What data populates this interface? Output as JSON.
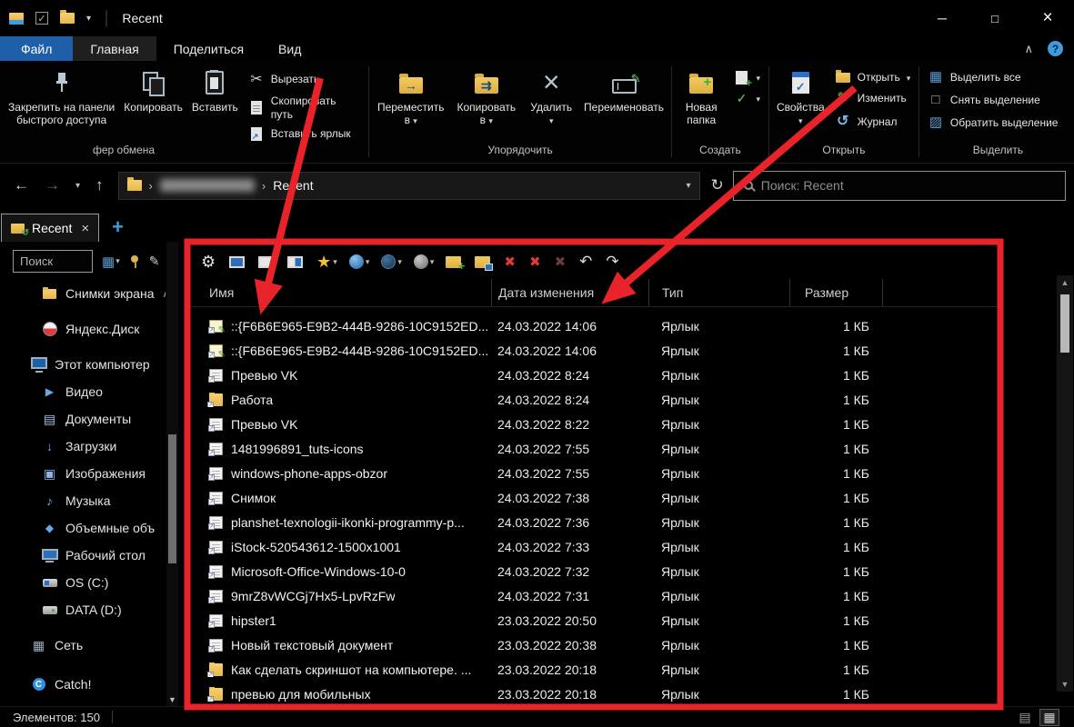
{
  "titlebar": {
    "title": "Recent",
    "quick_access_dropdown": "▾",
    "separator": "│",
    "controls": {
      "minimize": "─",
      "maximize": "□",
      "close": "×"
    }
  },
  "ribbon_tabs": {
    "file": "Файл",
    "home": "Главная",
    "share": "Поделиться",
    "view": "Вид",
    "collapse": "∧",
    "help": "?"
  },
  "ribbon": {
    "pin": "Закрепить на панели быстрого доступа",
    "copy": "Копировать",
    "paste": "Вставить",
    "cut": "Вырезать",
    "copy_path": "Скопировать путь",
    "paste_shortcut": "Вставить ярлык",
    "move_to": "Переместить в",
    "copy_to": "Копировать в",
    "delete": "Удалить",
    "rename": "Переименовать",
    "new_folder": "Новая папка",
    "properties": "Свойства",
    "open": "Открыть",
    "edit": "Изменить",
    "history": "Журнал",
    "select_all": "Выделить все",
    "select_none": "Снять выделение",
    "invert_selection": "Обратить выделение",
    "groups": {
      "clipboard": "фер обмена",
      "organize": "Упорядочить",
      "create": "Создать",
      "open": "Открыть",
      "select": "Выделить"
    }
  },
  "navbar": {
    "back": "←",
    "forward": "→",
    "history_dropdown": "▾",
    "up": "↑",
    "breadcrumb": {
      "separator": "›",
      "current": "Recent",
      "dropdown": "▾"
    },
    "refresh": "↻",
    "search_placeholder": "Поиск: Recent"
  },
  "tabbar": {
    "tab_label": "Recent",
    "close": "×",
    "new_tab": "+"
  },
  "sidebar": {
    "search_placeholder": "Поиск",
    "grid_icon": "▦",
    "grid_dropdown": "▾",
    "pen_icon": "✎",
    "items": [
      {
        "label": "Снимки экрана",
        "icon": "folder",
        "cls": "lvl1",
        "expander": "∧"
      },
      {
        "label": "Яндекс.Диск",
        "icon": "yandex",
        "cls": "lvl1 gap"
      },
      {
        "label": "Этот компьютер",
        "icon": "computer",
        "cls": "lvl0 gap"
      },
      {
        "label": "Видео",
        "icon": "videos",
        "cls": "lvl1"
      },
      {
        "label": "Документы",
        "icon": "documents",
        "cls": "lvl1"
      },
      {
        "label": "Загрузки",
        "icon": "downloads",
        "cls": "lvl1"
      },
      {
        "label": "Изображения",
        "icon": "pictures",
        "cls": "lvl1"
      },
      {
        "label": "Музыка",
        "icon": "music",
        "cls": "lvl1"
      },
      {
        "label": "Объемные объ",
        "icon": "objects3d",
        "cls": "lvl1"
      },
      {
        "label": "Рабочий стол",
        "icon": "desktop",
        "cls": "lvl1"
      },
      {
        "label": "OS (C:)",
        "icon": "drive-os",
        "cls": "lvl1"
      },
      {
        "label": "DATA (D:)",
        "icon": "drive",
        "cls": "lvl1"
      },
      {
        "label": "Сеть",
        "icon": "network",
        "cls": "lvl0 gap"
      },
      {
        "label": "Catch!",
        "icon": "catch",
        "cls": "lvl0 gap2"
      }
    ]
  },
  "list_toolbar": [
    {
      "name": "settings-button",
      "icon": "gear"
    },
    {
      "name": "window-view-1-button",
      "icon": "win-blue"
    },
    {
      "name": "window-view-2-button",
      "icon": "win-white"
    },
    {
      "name": "window-view-3-button",
      "icon": "win-split"
    },
    {
      "name": "favorites-button",
      "icon": "star",
      "dd": "▾"
    },
    {
      "name": "globe-blue-button",
      "icon": "globe-blue",
      "dd": "▾"
    },
    {
      "name": "globe-dark-button",
      "icon": "globe-dark",
      "dd": "▾"
    },
    {
      "name": "sphere-gray-button",
      "icon": "sphere-gray",
      "dd": "▾"
    },
    {
      "name": "new-folder-tab-button",
      "icon": "folder-plus"
    },
    {
      "name": "folder-window-button",
      "icon": "folder-win"
    },
    {
      "name": "close-tab-button",
      "icon": "x-red"
    },
    {
      "name": "close-tabs-button",
      "icon": "x-red"
    },
    {
      "name": "close-disabled-button",
      "icon": "x-dim"
    },
    {
      "name": "undo-close-button",
      "icon": "arrow-undo"
    },
    {
      "name": "redo-close-button",
      "icon": "arrow-redo"
    }
  ],
  "filelist": {
    "columns": [
      "Имя",
      "Дата изменения",
      "Тип",
      "Размер"
    ],
    "rows": [
      {
        "name": "::{F6B6E965-E9B2-444B-9286-10C9152ED...",
        "date": "24.03.2022 14:06",
        "type": "Ярлык",
        "size": "1 КБ",
        "icon": "note"
      },
      {
        "name": "::{F6B6E965-E9B2-444B-9286-10C9152ED...",
        "date": "24.03.2022 14:06",
        "type": "Ярлык",
        "size": "1 КБ",
        "icon": "note"
      },
      {
        "name": "Превью VK",
        "date": "24.03.2022 8:24",
        "type": "Ярлык",
        "size": "1 КБ",
        "icon": "doc"
      },
      {
        "name": "Работа",
        "date": "24.03.2022 8:24",
        "type": "Ярлык",
        "size": "1 КБ",
        "icon": "folder"
      },
      {
        "name": "Превью VK",
        "date": "24.03.2022 8:22",
        "type": "Ярлык",
        "size": "1 КБ",
        "icon": "doc"
      },
      {
        "name": "1481996891_tuts-icons",
        "date": "24.03.2022 7:55",
        "type": "Ярлык",
        "size": "1 КБ",
        "icon": "doc"
      },
      {
        "name": "windows-phone-apps-obzor",
        "date": "24.03.2022 7:55",
        "type": "Ярлык",
        "size": "1 КБ",
        "icon": "doc"
      },
      {
        "name": "Снимок",
        "date": "24.03.2022 7:38",
        "type": "Ярлык",
        "size": "1 КБ",
        "icon": "doc"
      },
      {
        "name": "planshet-texnologii-ikonki-programmy-p...",
        "date": "24.03.2022 7:36",
        "type": "Ярлык",
        "size": "1 КБ",
        "icon": "doc"
      },
      {
        "name": "iStock-520543612-1500x1001",
        "date": "24.03.2022 7:33",
        "type": "Ярлык",
        "size": "1 КБ",
        "icon": "doc"
      },
      {
        "name": "Microsoft-Office-Windows-10-0",
        "date": "24.03.2022 7:32",
        "type": "Ярлык",
        "size": "1 КБ",
        "icon": "doc"
      },
      {
        "name": "9mrZ8vWCGj7Hx5-LpvRzFw",
        "date": "24.03.2022 7:31",
        "type": "Ярлык",
        "size": "1 КБ",
        "icon": "doc"
      },
      {
        "name": "hipster1",
        "date": "23.03.2022 20:50",
        "type": "Ярлык",
        "size": "1 КБ",
        "icon": "doc"
      },
      {
        "name": "Новый текстовый документ",
        "date": "23.03.2022 20:38",
        "type": "Ярлык",
        "size": "1 КБ",
        "icon": "doc"
      },
      {
        "name": "Как сделать скриншот на компьютере. ...",
        "date": "23.03.2022 20:18",
        "type": "Ярлык",
        "size": "1 КБ",
        "icon": "folder"
      },
      {
        "name": "превью для мобильных",
        "date": "23.03.2022 20:18",
        "type": "Ярлык",
        "size": "1 КБ",
        "icon": "folder"
      }
    ]
  },
  "scrollbar": {
    "up": "▲",
    "down": "▼"
  },
  "statusbar": {
    "items_count": "Элементов: 150",
    "view_icons": {
      "details": "▤",
      "thumbnails": "▦"
    }
  }
}
